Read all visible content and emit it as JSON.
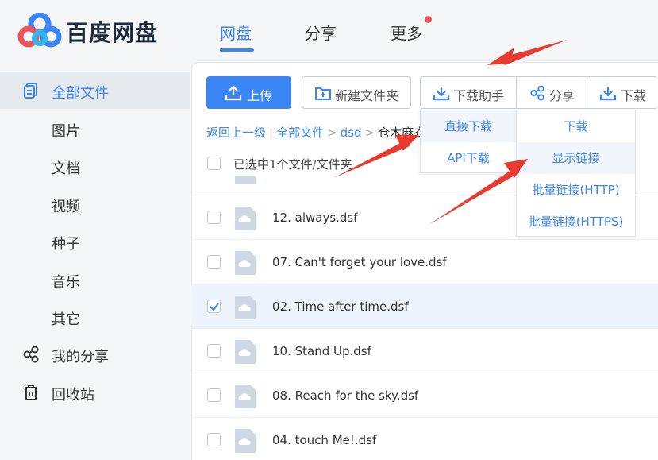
{
  "brand": {
    "name": "百度网盘"
  },
  "topnav": [
    {
      "label": "网盘",
      "active": true
    },
    {
      "label": "分享",
      "active": false
    },
    {
      "label": "更多",
      "active": false,
      "badge": true
    }
  ],
  "sidebar": {
    "items": [
      {
        "label": "全部文件",
        "icon": "files-icon",
        "active": true
      },
      {
        "label": "图片"
      },
      {
        "label": "文档"
      },
      {
        "label": "视频"
      },
      {
        "label": "种子"
      },
      {
        "label": "音乐"
      },
      {
        "label": "其它"
      },
      {
        "label": "我的分享",
        "icon": "share-icon"
      },
      {
        "label": "回收站",
        "icon": "trash-icon"
      }
    ]
  },
  "toolbar": {
    "upload": "上传",
    "new_folder": "新建文件夹",
    "download_helper": "下载助手",
    "share": "分享",
    "download": "下载"
  },
  "breadcrumb": {
    "back": "返回上一级",
    "all": "全部文件",
    "folder": "dsd",
    "current": "仓木麻衣"
  },
  "selection": {
    "text": "已选中1个文件/文件夹"
  },
  "files": [
    {
      "name": "12. always.dsf",
      "checked": false
    },
    {
      "name": "07. Can't forget your love.dsf",
      "checked": false
    },
    {
      "name": "02. Time after time.dsf",
      "checked": true
    },
    {
      "name": "10. Stand Up.dsf",
      "checked": false
    },
    {
      "name": "08. Reach for the sky.dsf",
      "checked": false
    },
    {
      "name": "04. touch Me!.dsf",
      "checked": false
    }
  ],
  "download_helper_menu": [
    {
      "label": "直接下载"
    },
    {
      "label": "API下载"
    }
  ],
  "share_menu": [
    {
      "label": "下载"
    },
    {
      "label": "显示链接",
      "hover": true
    },
    {
      "label": "批量链接(HTTP)"
    },
    {
      "label": "批量链接(HTTPS)"
    }
  ],
  "colors": {
    "accent": "#3b86f5",
    "badge": "#f0525a",
    "arrow": "#e83a2f"
  }
}
